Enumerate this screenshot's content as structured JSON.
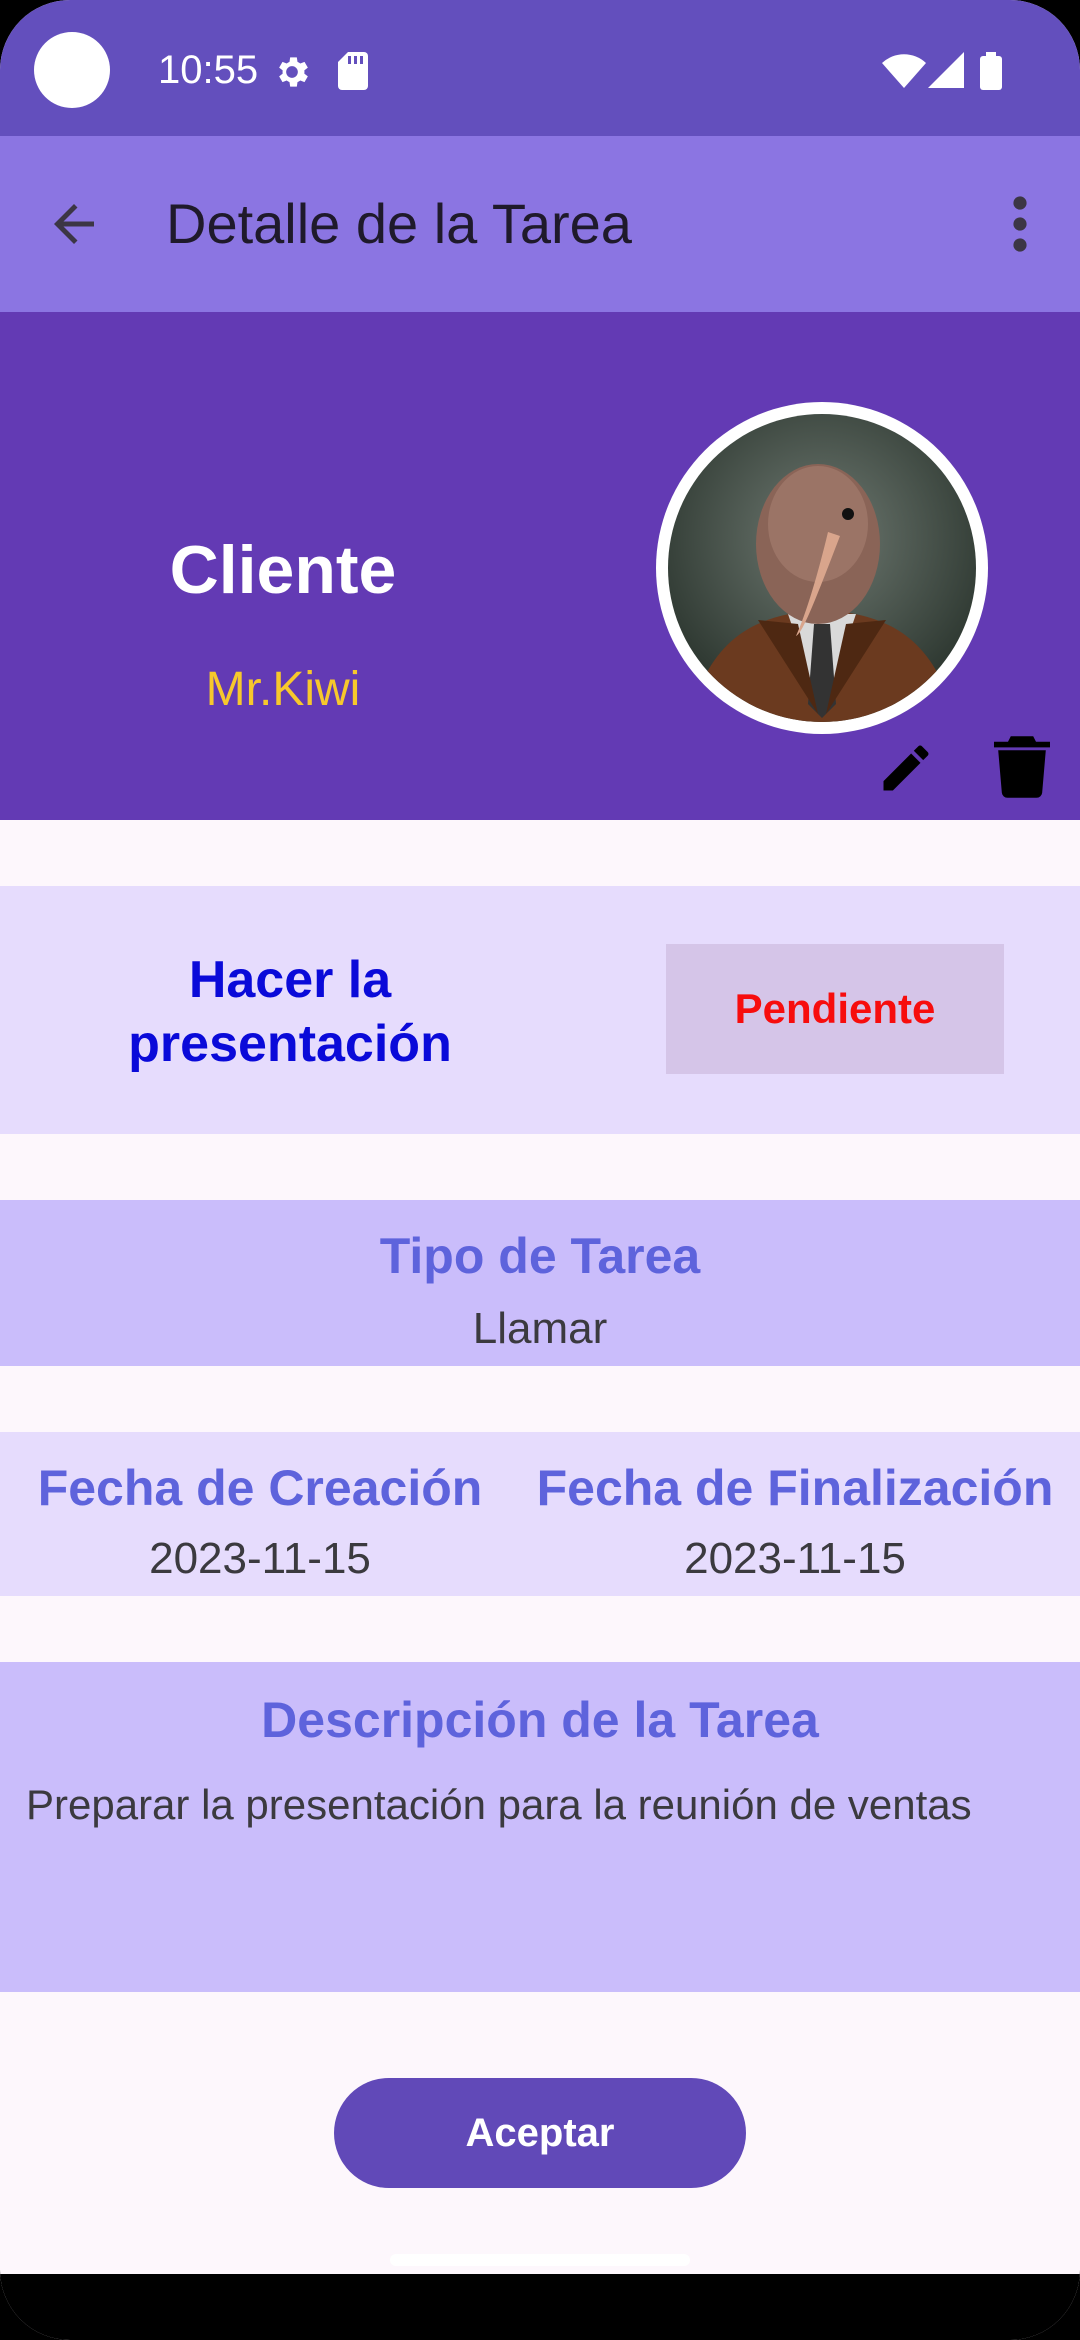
{
  "status_bar": {
    "time": "10:55",
    "icons": [
      "gear-icon",
      "sd-card-icon",
      "wifi-icon",
      "signal-icon",
      "battery-icon"
    ]
  },
  "app_bar": {
    "title": "Detalle de la Tarea",
    "back_icon": "arrow-left-icon",
    "menu_icon": "more-vertical-icon"
  },
  "header": {
    "client_label": "Cliente",
    "client_name": "Mr.Kiwi",
    "colors": {
      "background": "#633ab4",
      "name": "#f7c82c"
    }
  },
  "task": {
    "title": "Hacer la presentación",
    "status": "Pendiente",
    "colors": {
      "title": "#0a0ad9",
      "status": "#f70d0d"
    }
  },
  "tipo": {
    "heading": "Tipo de Tarea",
    "value": "Llamar"
  },
  "dates": {
    "created_heading": "Fecha de Creación",
    "created_value": "2023-11-15",
    "finished_heading": "Fecha de Finalización",
    "finished_value": "2023-11-15"
  },
  "description": {
    "heading": "Descripción de la Tarea",
    "text": "Preparar la presentación para la reunión de ventas"
  },
  "actions": {
    "accept_label": "Aceptar"
  }
}
